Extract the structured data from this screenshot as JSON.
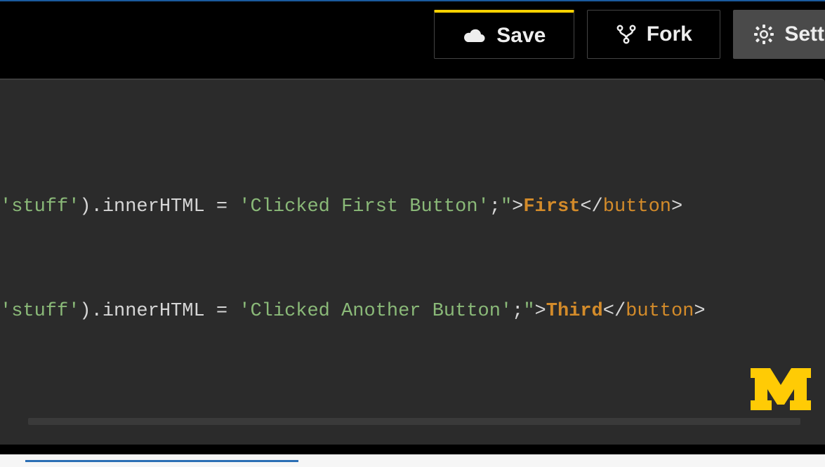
{
  "toolbar": {
    "save_label": "Save",
    "fork_label": "Fork",
    "settings_label": "Sett"
  },
  "code": {
    "line1": {
      "str_open": "'stuff'",
      "paren": ")",
      "dot": ".",
      "method": "innerHTML",
      "eq": " = ",
      "value": "'Clicked First Button'",
      "semi": ";",
      "quote_close": "\"",
      "gt": ">",
      "text": "First",
      "close_open": "</",
      "tag": "button",
      "close_gt": ">"
    },
    "line2": {
      "str_open": "'stuff'",
      "paren": ")",
      "dot": ".",
      "method": "innerHTML",
      "eq": " = ",
      "value": "'Clicked Another Button'",
      "semi": ";",
      "quote_close": "\"",
      "gt": ">",
      "text": "Third",
      "close_open": "</",
      "tag": "button",
      "close_gt": ">"
    }
  },
  "logo": {
    "name": "michigan-M"
  }
}
